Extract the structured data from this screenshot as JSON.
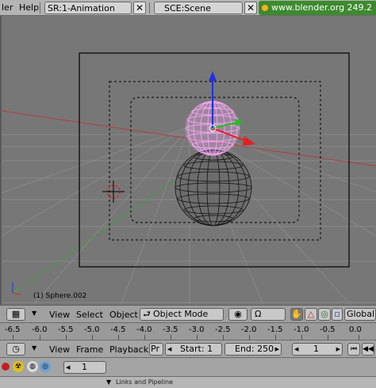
{
  "topbar": {
    "menu_partial": "ler",
    "menu_help": "Help",
    "screen_field": "SR:1-Animation",
    "scene_field": "SCE:Scene",
    "url_text": "www.blender.org 249.2"
  },
  "viewport": {
    "status_text": "(1) Sphere.002"
  },
  "header3d": {
    "view": "View",
    "select": "Select",
    "object": "Object",
    "mode": "Object Mode",
    "orientation": "Global"
  },
  "timeline": {
    "ticks": [
      "-6.5",
      "-6.0",
      "-5.5",
      "-5.0",
      "-4.5",
      "-4.0",
      "-3.5",
      "-3.0",
      "-2.5",
      "-2.0",
      "-1.5",
      "-1.0",
      "-0.5",
      "0.0"
    ]
  },
  "timeline_header": {
    "view": "View",
    "frame": "Frame",
    "playback": "Playback",
    "pr": "Pr",
    "start": "Start: 1",
    "end": "End: 250",
    "current_frame": "1"
  },
  "buttons_window": {
    "frame_value": "1",
    "panel_label": "Links and Pipeline"
  },
  "colors": {
    "viewport_bg": "#777777",
    "selected_sphere": "#f0a8f0",
    "axis_x": "#e02020",
    "axis_y": "#20c020",
    "axis_z": "#2030e0",
    "url_bg": "#3c8a2e"
  }
}
